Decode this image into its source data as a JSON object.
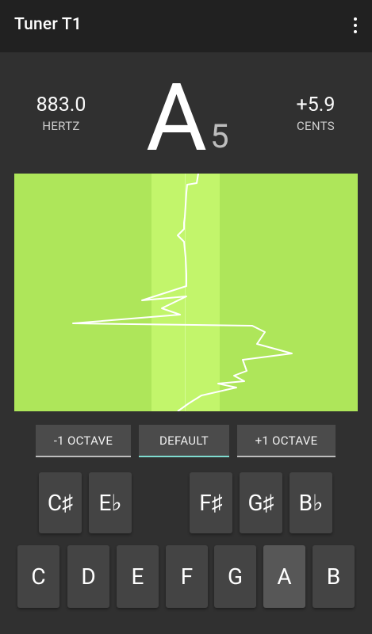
{
  "app": {
    "title": "Tuner T1",
    "menu_icon": "more-vert-icon"
  },
  "readout": {
    "frequency": "883.0",
    "frequency_label": "HERTZ",
    "note": "A",
    "octave": "5",
    "cents": "+5.9",
    "cents_label": "CENTS"
  },
  "graph": {
    "background_color": "#aee65a",
    "band_color": "#c2f56b",
    "line_color": "#ffffff"
  },
  "octave_buttons": {
    "down": "-1 OCTAVE",
    "default": "DEFAULT",
    "up": "+1 OCTAVE",
    "selected": "default"
  },
  "keys": {
    "sharps": [
      "C♯",
      "E♭",
      "F♯",
      "G♯",
      "B♭"
    ],
    "naturals": [
      "C",
      "D",
      "E",
      "F",
      "G",
      "A",
      "B"
    ],
    "active": "A"
  },
  "colors": {
    "accent": "#7fdcd0",
    "appbar": "#212121",
    "background": "#303030",
    "key": "#444444"
  }
}
